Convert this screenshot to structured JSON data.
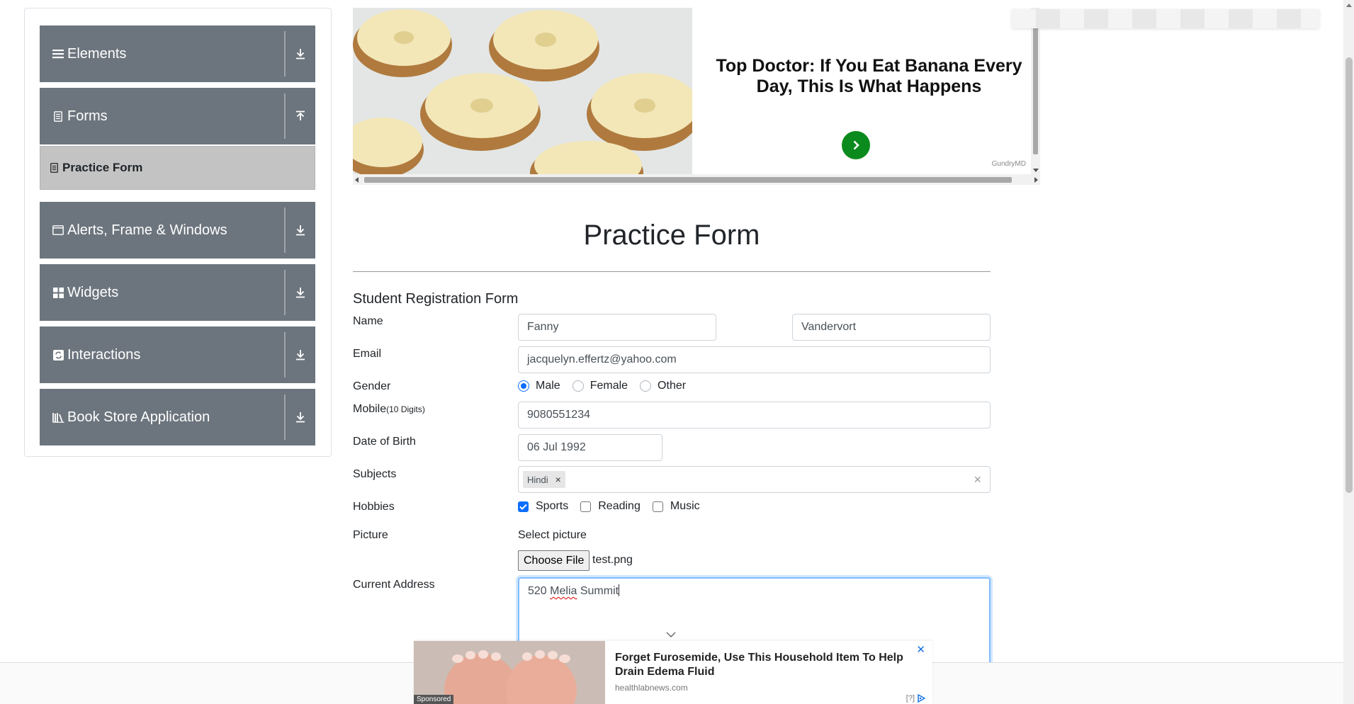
{
  "sidebar": {
    "groups": [
      {
        "label": "Elements",
        "icon": "hamburger-icon"
      },
      {
        "label": "Forms",
        "icon": "document-icon"
      },
      {
        "label": "Alerts, Frame & Windows",
        "icon": "window-icon"
      },
      {
        "label": "Widgets",
        "icon": "widgets-grid-icon"
      },
      {
        "label": "Interactions",
        "icon": "interactions-icon"
      },
      {
        "label": "Book Store Application",
        "icon": "books-icon"
      }
    ],
    "active_item": {
      "label": "Practice Form",
      "icon": "form-icon"
    }
  },
  "top_ad": {
    "headline": "Top Doctor: If You Eat Banana Every Day, This Is What Happens",
    "source": "GundryMD",
    "action_color": "#0b8a1d"
  },
  "form": {
    "page_title": "Practice Form",
    "section_title": "Student Registration Form",
    "labels": {
      "name": "Name",
      "email": "Email",
      "gender": "Gender",
      "mobile": "Mobile",
      "mobile_hint": "(10 Digits)",
      "dob": "Date of Birth",
      "subjects": "Subjects",
      "hobbies": "Hobbies",
      "picture": "Picture",
      "current_address": "Current Address"
    },
    "values": {
      "first_name": "Fanny",
      "last_name": "Vandervort",
      "email": "jacquelyn.effertz@yahoo.com",
      "mobile": "9080551234",
      "dob": "06 Jul 1992",
      "address_word1": "520",
      "address_word2": "Melia",
      "address_word3": "Summit",
      "file_name": "test.png"
    },
    "gender_options": [
      {
        "label": "Male",
        "checked": true
      },
      {
        "label": "Female",
        "checked": false
      },
      {
        "label": "Other",
        "checked": false
      }
    ],
    "subjects_chips": [
      "Hindi"
    ],
    "hobbies": [
      {
        "label": "Sports",
        "checked": true
      },
      {
        "label": "Reading",
        "checked": false
      },
      {
        "label": "Music",
        "checked": false
      }
    ],
    "picture_hint": "Select picture",
    "file_button": "Choose File",
    "accent_color": "#0d6efd"
  },
  "bottom_ad": {
    "headline": "Forget Furosemide, Use This Household Item To Help Drain Edema Fluid",
    "domain": "healthlabnews.com",
    "sponsored": "Sponsored",
    "info": "[?]"
  }
}
